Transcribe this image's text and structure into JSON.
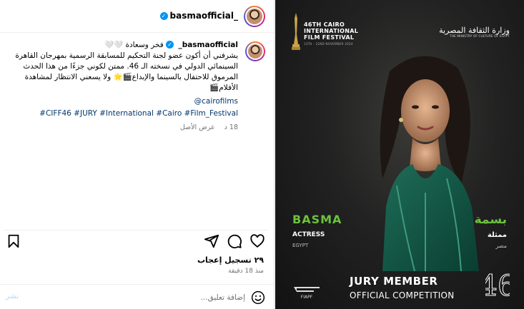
{
  "post": {
    "username": "basmaofficial_",
    "caption_username": "basmaofficial_",
    "caption_first": "فخر وسعادة 🤍🤍",
    "caption_body": "يشرفني أن أكون عضو لجنة التحكيم للمسابقة الرسمية بمهرجان القاهرة السينمائي الدولي في نسخته الـ 46. ممتن لكوني جزءًا من هذا الحدث المرموق للاحتفال بالسينما والإبداع🎬🌟 ولا يسعني الانتظار لمشاهدة الأفلام🎬",
    "mention": "@cairofilms",
    "hashtags": "#CIFF46 #JURY #International #Cairo #Film_Festival",
    "age": "18 د",
    "see_translation": "عرض الأصل",
    "likes": "٢٩ تسجيل إعجاب",
    "time_ago": "منذ 18 دقيقة",
    "comment_placeholder": "إضافة تعليق...",
    "post_label": "نشر"
  },
  "icons": {
    "like": "heart-icon",
    "comment": "comment-icon",
    "share": "send-icon",
    "save": "bookmark-icon",
    "emoji": "emoji-icon",
    "verified": "verified-badge-icon"
  },
  "poster": {
    "festival_line1": "46TH CAIRO",
    "festival_line2": "INTERNATIONAL",
    "festival_line3": "FILM FESTIVAL",
    "festival_dates": "13TH - 22ND NOVEMBER 2024",
    "ministry_ar": "وزارة الثقافة المصرية",
    "ministry_en": "THE MINISTRY OF CULTURE OF EGYPT",
    "name_en": "BASMA",
    "role_en": "ACTRESS",
    "country_en": "EGYPT",
    "name_ar": "بسمة",
    "role_ar": "ممثلة",
    "country_ar": "مصر",
    "jury_line": "JURY MEMBER",
    "competition_line": "OFFICIAL COMPETITION",
    "fiapf": "FIAPF",
    "edition": "46"
  },
  "colors": {
    "accent_green": "#6bc23e",
    "link_blue": "#00376b",
    "verified_blue": "#0095f6"
  }
}
